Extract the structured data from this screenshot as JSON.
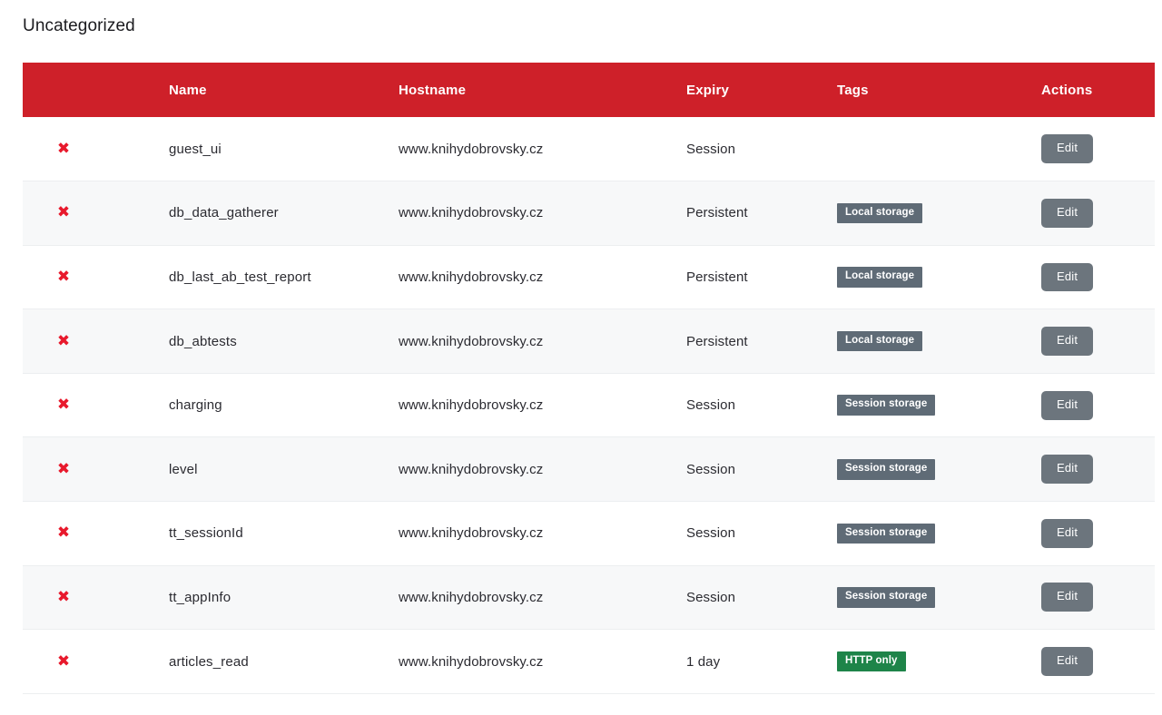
{
  "section": {
    "title": "Uncategorized"
  },
  "colors": {
    "header_red": "#ce2029",
    "edit_button_gray": "#6c757d",
    "tag_gray": "#5f6b76",
    "tag_green": "#1e8449",
    "delete_red": "#e8192c",
    "row_stripe": "#f7f8f9"
  },
  "table": {
    "columns": [
      {
        "key": "delete",
        "label": ""
      },
      {
        "key": "name",
        "label": "Name"
      },
      {
        "key": "hostname",
        "label": "Hostname"
      },
      {
        "key": "expiry",
        "label": "Expiry"
      },
      {
        "key": "tags",
        "label": "Tags"
      },
      {
        "key": "actions",
        "label": "Actions"
      }
    ],
    "delete_icon": "✖",
    "edit_label": "Edit",
    "rows": [
      {
        "name": "guest_ui",
        "hostname": "www.knihydobrovsky.cz",
        "expiry": "Session",
        "tag": "",
        "tag_color": "",
        "action": "Edit"
      },
      {
        "name": "db_data_gatherer",
        "hostname": "www.knihydobrovsky.cz",
        "expiry": "Persistent",
        "tag": "Local storage",
        "tag_color": "gray",
        "action": "Edit"
      },
      {
        "name": "db_last_ab_test_report",
        "hostname": "www.knihydobrovsky.cz",
        "expiry": "Persistent",
        "tag": "Local storage",
        "tag_color": "gray",
        "action": "Edit"
      },
      {
        "name": "db_abtests",
        "hostname": "www.knihydobrovsky.cz",
        "expiry": "Persistent",
        "tag": "Local storage",
        "tag_color": "gray",
        "action": "Edit"
      },
      {
        "name": "charging",
        "hostname": "www.knihydobrovsky.cz",
        "expiry": "Session",
        "tag": "Session storage",
        "tag_color": "gray",
        "action": "Edit"
      },
      {
        "name": "level",
        "hostname": "www.knihydobrovsky.cz",
        "expiry": "Session",
        "tag": "Session storage",
        "tag_color": "gray",
        "action": "Edit"
      },
      {
        "name": "tt_sessionId",
        "hostname": "www.knihydobrovsky.cz",
        "expiry": "Session",
        "tag": "Session storage",
        "tag_color": "gray",
        "action": "Edit"
      },
      {
        "name": "tt_appInfo",
        "hostname": "www.knihydobrovsky.cz",
        "expiry": "Session",
        "tag": "Session storage",
        "tag_color": "gray",
        "action": "Edit"
      },
      {
        "name": "articles_read",
        "hostname": "www.knihydobrovsky.cz",
        "expiry": "1 day",
        "tag": "HTTP only",
        "tag_color": "green",
        "action": "Edit"
      }
    ]
  }
}
